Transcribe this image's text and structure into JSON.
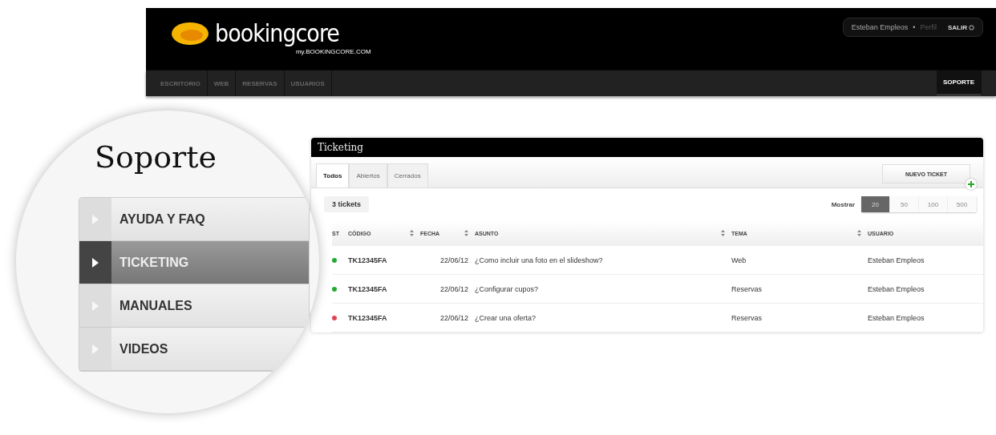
{
  "header": {
    "logo": "bookingcore",
    "logo_subtitle": "my.BOOKINGCORE.COM",
    "user_name": "Esteban Empleos",
    "separator": "•",
    "profile_link": "Perfil",
    "logout": "SALIR"
  },
  "nav": [
    {
      "label": "ESCRITORIO",
      "selected": false
    },
    {
      "label": "WEB",
      "selected": false
    },
    {
      "label": "RESERVAS",
      "selected": false
    },
    {
      "label": "USUARIOS",
      "selected": false
    },
    {
      "label": "SOPORTE",
      "selected": true
    }
  ],
  "magnifier": {
    "title": "Soporte",
    "menu": [
      {
        "label": "AYUDA Y FAQ",
        "selected": false
      },
      {
        "label": "TICKETING",
        "selected": true
      },
      {
        "label": "MANUALES",
        "selected": false
      },
      {
        "label": "VIDEOS",
        "selected": false
      }
    ]
  },
  "panel": {
    "title": "Ticketing",
    "tabs": [
      {
        "label": "Todos",
        "selected": true
      },
      {
        "label": "Abiertos",
        "selected": false
      },
      {
        "label": "Cerrados",
        "selected": false
      }
    ],
    "new_ticket": "NUEVO TICKET",
    "count": "3 tickets",
    "show_label": "Mostrar",
    "page_sizes": [
      {
        "label": "20",
        "selected": true
      },
      {
        "label": "50",
        "selected": false
      },
      {
        "label": "100",
        "selected": false
      },
      {
        "label": "500",
        "selected": false
      }
    ]
  },
  "table": {
    "columns": [
      {
        "label": "ST",
        "sortable": false
      },
      {
        "label": "CÓDIGO",
        "sortable": true
      },
      {
        "label": "FECHA",
        "sortable": true
      },
      {
        "label": "ASUNTO",
        "sortable": true
      },
      {
        "label": "TEMA",
        "sortable": true
      },
      {
        "label": "USUARIO",
        "sortable": false
      }
    ],
    "rows": [
      {
        "color": "#22aa33",
        "cells": [
          "",
          "TK12345FA",
          "22/06/12",
          "¿Como incluir una foto en el slideshow?",
          "Web",
          "Esteban Empleos"
        ]
      },
      {
        "color": "#22aa33",
        "cells": [
          "",
          "TK12345FA",
          "22/06/12",
          "¿Configurar cupos?",
          "Reservas",
          "Esteban Empleos"
        ]
      },
      {
        "color": "#e04455",
        "cells": [
          "",
          "TK12345FA",
          "22/06/12",
          "¿Crear una oferta?",
          "Reservas",
          "Esteban Empleos"
        ]
      }
    ]
  }
}
